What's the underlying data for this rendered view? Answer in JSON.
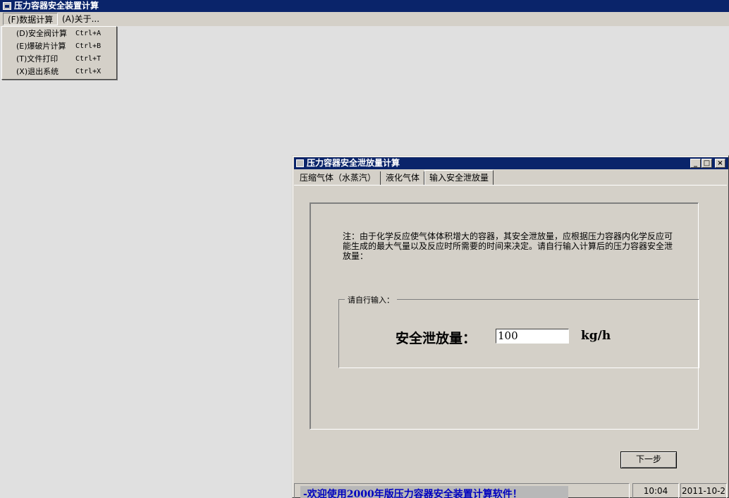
{
  "main_window": {
    "title": "压力容器安全装置计算",
    "menu": [
      {
        "label": "(F)数据计算"
      },
      {
        "label": "(A)关于..."
      }
    ],
    "dropdown": [
      {
        "label": "(D)安全阀计算",
        "accel": "Ctrl+A"
      },
      {
        "label": "(E)爆破片计算",
        "accel": "Ctrl+B"
      },
      {
        "label": "(T)文件打印",
        "accel": "Ctrl+T"
      },
      {
        "label": "(X)退出系统",
        "accel": "Ctrl+X"
      }
    ]
  },
  "child_window": {
    "title": "压力容器安全泄放量计算",
    "controls": {
      "minimize": "_",
      "maximize": "□",
      "close": "×"
    },
    "tabs": [
      {
        "label": "压缩气体（水蒸汽）"
      },
      {
        "label": "液化气体"
      },
      {
        "label": "输入安全泄放量"
      }
    ],
    "note": "注：由于化学反应使气体体积增大的容器，其安全泄放量，应根据压力容器内化学反应可能生成的最大气量以及反应时所需要的时间来决定。请自行输入计算后的压力容器安全泄放量：",
    "group_title": "请自行输入：",
    "field_label": "安全泄放量：",
    "field_value": "100",
    "field_unit": "kg/h",
    "next_button": "下一步"
  },
  "statusbar": {
    "message": "-欢迎使用2000年版压力容器安全装置计算软件！",
    "time": "10:04",
    "date": "2011-10-2"
  }
}
